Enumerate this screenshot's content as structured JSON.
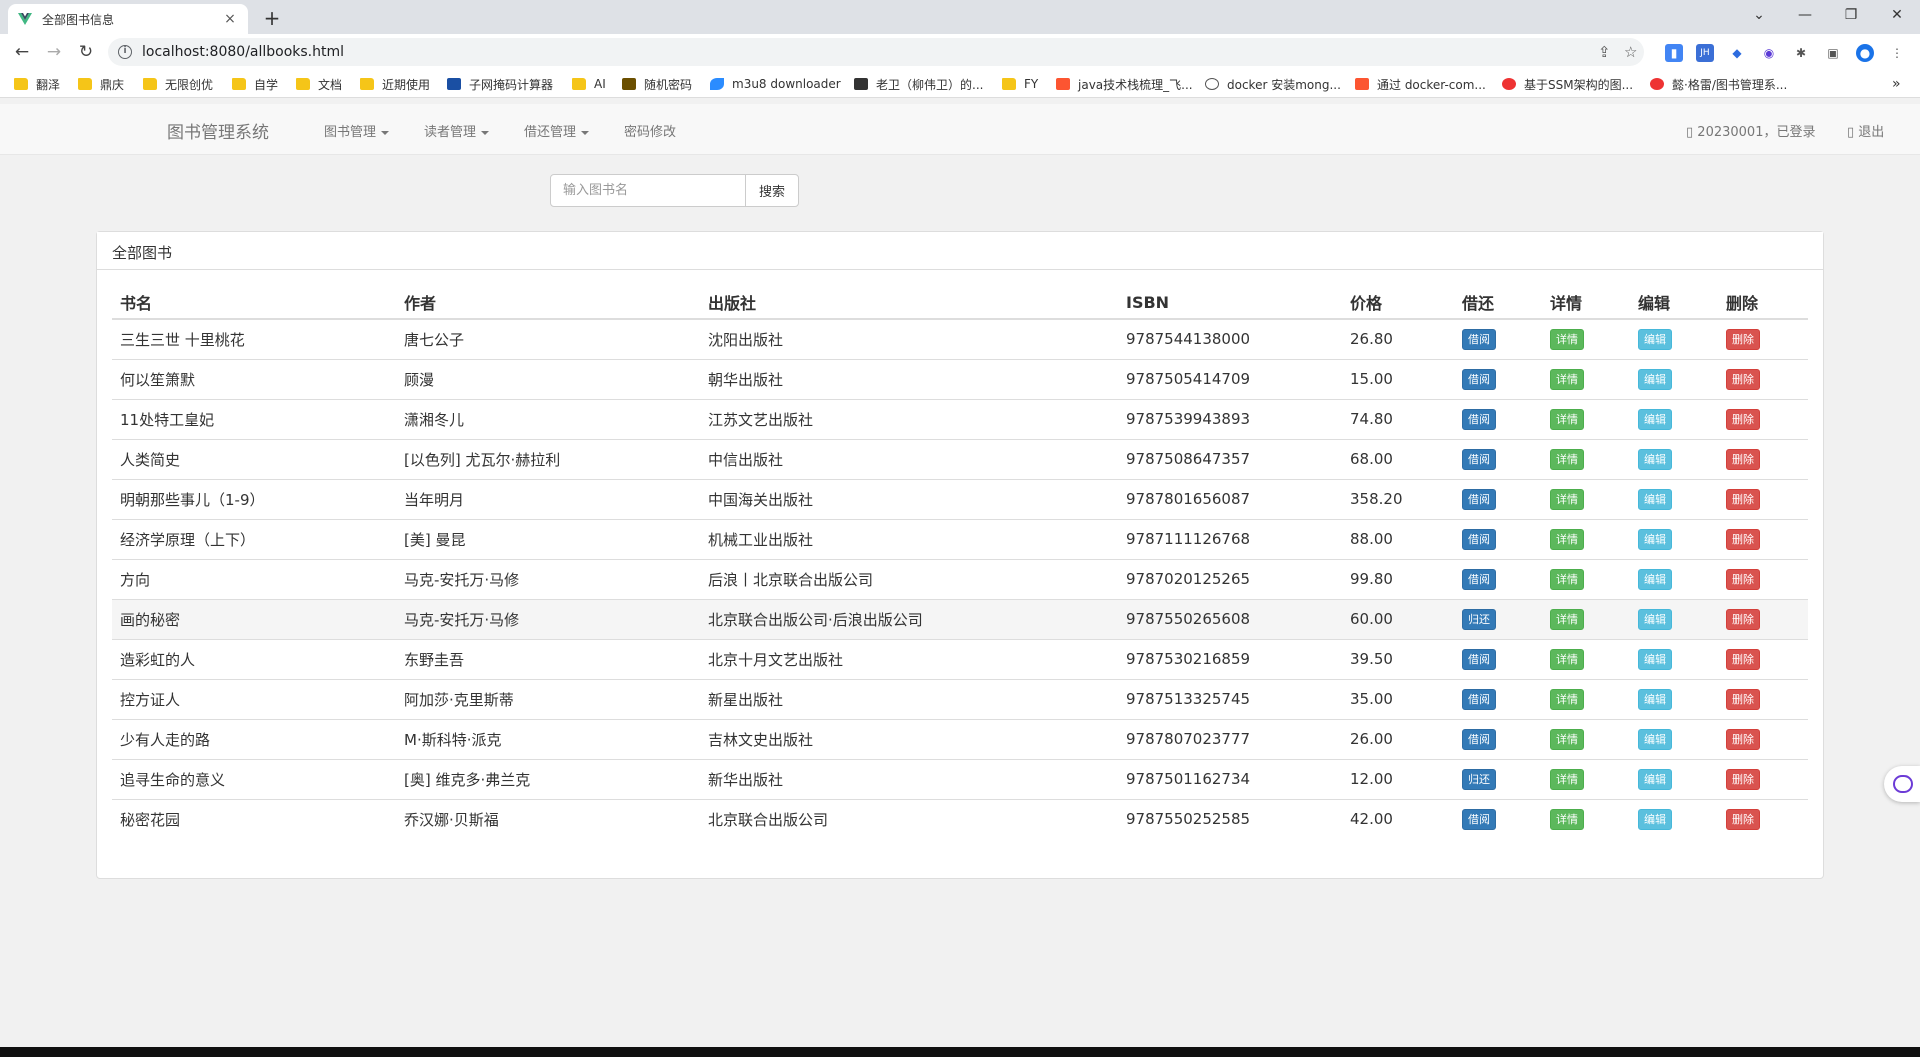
{
  "browser": {
    "tab_title": "全部图书信息",
    "tab_close": "×",
    "new_tab": "+",
    "url": "localhost:8080/allbooks.html",
    "bookmarks": [
      {
        "label": "翻泽",
        "icon": "folder"
      },
      {
        "label": "鼎庆",
        "icon": "folder"
      },
      {
        "label": "无限创优",
        "icon": "folder"
      },
      {
        "label": "自学",
        "icon": "folder"
      },
      {
        "label": "文档",
        "icon": "folder"
      },
      {
        "label": "近期使用",
        "icon": "folder"
      },
      {
        "label": "子网掩码计算器",
        "icon": "ip-icon"
      },
      {
        "label": "AI",
        "icon": "folder"
      },
      {
        "label": "随机密码",
        "icon": "site-icon"
      },
      {
        "label": "m3u8 downloader",
        "icon": "plane-icon"
      },
      {
        "label": "老卫（柳伟卫）的...",
        "icon": "avatar-icon"
      },
      {
        "label": "FY",
        "icon": "folder"
      },
      {
        "label": "java技术栈梳理_飞...",
        "icon": "csdn-icon"
      },
      {
        "label": "docker 安装mong...",
        "icon": "leaf-icon"
      },
      {
        "label": "通过 docker-com...",
        "icon": "csdn-icon"
      },
      {
        "label": "基于SSM架构的图...",
        "icon": "bilibili-icon"
      },
      {
        "label": "懿·格雷/图书管理系...",
        "icon": "bilibili-icon"
      }
    ],
    "bookmarks_more": "»"
  },
  "navbar": {
    "brand": "图书管理系统",
    "menu": [
      "图书管理",
      "读者管理",
      "借还管理"
    ],
    "password_link": "密码修改",
    "user_status": "20230001，已登录",
    "logout": "退出"
  },
  "search": {
    "placeholder": "输入图书名",
    "button": "搜索"
  },
  "panel": {
    "heading": "全部图书"
  },
  "table": {
    "headers": [
      "书名",
      "作者",
      "出版社",
      "ISBN",
      "价格",
      "借还",
      "详情",
      "编辑",
      "删除"
    ],
    "rows": [
      {
        "title": "三生三世 十里桃花",
        "author": "唐七公子",
        "publisher": "沈阳出版社",
        "isbn": "9787544138000",
        "price": "26.80",
        "borrow": "借阅",
        "detail": "详情",
        "edit": "编辑",
        "delete": "删除"
      },
      {
        "title": "何以笙箫默",
        "author": "顾漫",
        "publisher": "朝华出版社",
        "isbn": "9787505414709",
        "price": "15.00",
        "borrow": "借阅",
        "detail": "详情",
        "edit": "编辑",
        "delete": "删除"
      },
      {
        "title": "11处特工皇妃",
        "author": "潇湘冬儿",
        "publisher": "江苏文艺出版社",
        "isbn": "9787539943893",
        "price": "74.80",
        "borrow": "借阅",
        "detail": "详情",
        "edit": "编辑",
        "delete": "删除"
      },
      {
        "title": "人类简史",
        "author": "[以色列] 尤瓦尔·赫拉利",
        "publisher": "中信出版社",
        "isbn": "9787508647357",
        "price": "68.00",
        "borrow": "借阅",
        "detail": "详情",
        "edit": "编辑",
        "delete": "删除"
      },
      {
        "title": "明朝那些事儿（1-9）",
        "author": "当年明月",
        "publisher": "中国海关出版社",
        "isbn": "9787801656087",
        "price": "358.20",
        "borrow": "借阅",
        "detail": "详情",
        "edit": "编辑",
        "delete": "删除"
      },
      {
        "title": "经济学原理（上下）",
        "author": "[美] 曼昆",
        "publisher": "机械工业出版社",
        "isbn": "9787111126768",
        "price": "88.00",
        "borrow": "借阅",
        "detail": "详情",
        "edit": "编辑",
        "delete": "删除"
      },
      {
        "title": "方向",
        "author": "马克-安托万·马修",
        "publisher": "后浪丨北京联合出版公司",
        "isbn": "9787020125265",
        "price": "99.80",
        "borrow": "借阅",
        "detail": "详情",
        "edit": "编辑",
        "delete": "删除"
      },
      {
        "title": "画的秘密",
        "author": "马克-安托万·马修",
        "publisher": "北京联合出版公司·后浪出版公司",
        "isbn": "9787550265608",
        "price": "60.00",
        "borrow": "归还",
        "detail": "详情",
        "edit": "编辑",
        "delete": "删除"
      },
      {
        "title": "造彩虹的人",
        "author": "东野圭吾",
        "publisher": "北京十月文艺出版社",
        "isbn": "9787530216859",
        "price": "39.50",
        "borrow": "借阅",
        "detail": "详情",
        "edit": "编辑",
        "delete": "删除"
      },
      {
        "title": "控方证人",
        "author": "阿加莎·克里斯蒂",
        "publisher": "新星出版社",
        "isbn": "9787513325745",
        "price": "35.00",
        "borrow": "借阅",
        "detail": "详情",
        "edit": "编辑",
        "delete": "删除"
      },
      {
        "title": "少有人走的路",
        "author": "M·斯科特·派克",
        "publisher": "吉林文史出版社",
        "isbn": "9787807023777",
        "price": "26.00",
        "borrow": "借阅",
        "detail": "详情",
        "edit": "编辑",
        "delete": "删除"
      },
      {
        "title": "追寻生命的意义",
        "author": "[奥] 维克多·弗兰克",
        "publisher": "新华出版社",
        "isbn": "9787501162734",
        "price": "12.00",
        "borrow": "归还",
        "detail": "详情",
        "edit": "编辑",
        "delete": "删除"
      },
      {
        "title": "秘密花园",
        "author": "乔汉娜·贝斯福",
        "publisher": "北京联合出版公司",
        "isbn": "9787550252585",
        "price": "42.00",
        "borrow": "借阅",
        "detail": "详情",
        "edit": "编辑",
        "delete": "删除"
      }
    ]
  },
  "colors": {
    "primary": "#337ab7",
    "success": "#5cb85c",
    "info": "#5bc0de",
    "danger": "#d9534f"
  }
}
